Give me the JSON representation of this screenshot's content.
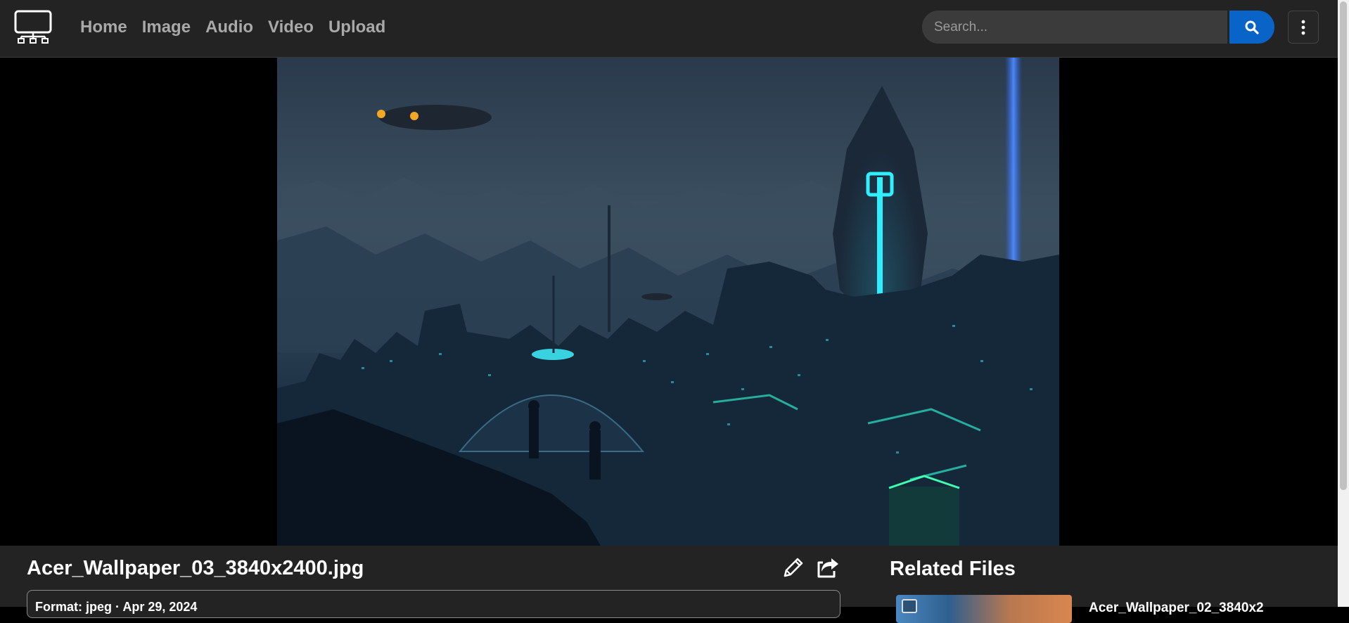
{
  "header": {
    "logo_icon": "monitor-tree-icon",
    "nav": [
      {
        "label": "Home"
      },
      {
        "label": "Image"
      },
      {
        "label": "Audio"
      },
      {
        "label": "Video"
      },
      {
        "label": "Upload"
      }
    ],
    "search": {
      "placeholder": "Search...",
      "value": "",
      "button_icon": "search-icon"
    },
    "menu_icon": "vertical-ellipsis-icon"
  },
  "viewer": {
    "image_description_icon": "cyberpunk-city-artwork"
  },
  "file": {
    "title": "Acer_Wallpaper_03_3840x2400.jpg",
    "details": "Format: jpeg · Apr 29, 2024",
    "edit_icon": "pencil-icon",
    "share_icon": "share-icon"
  },
  "related": {
    "heading": "Related Files",
    "items": [
      {
        "name": "Acer_Wallpaper_02_3840x2"
      }
    ]
  },
  "colors": {
    "topbar": "#232323",
    "accent": "#0a64c8",
    "nav_text": "#a9a9a9",
    "page_bg": "#000000"
  }
}
